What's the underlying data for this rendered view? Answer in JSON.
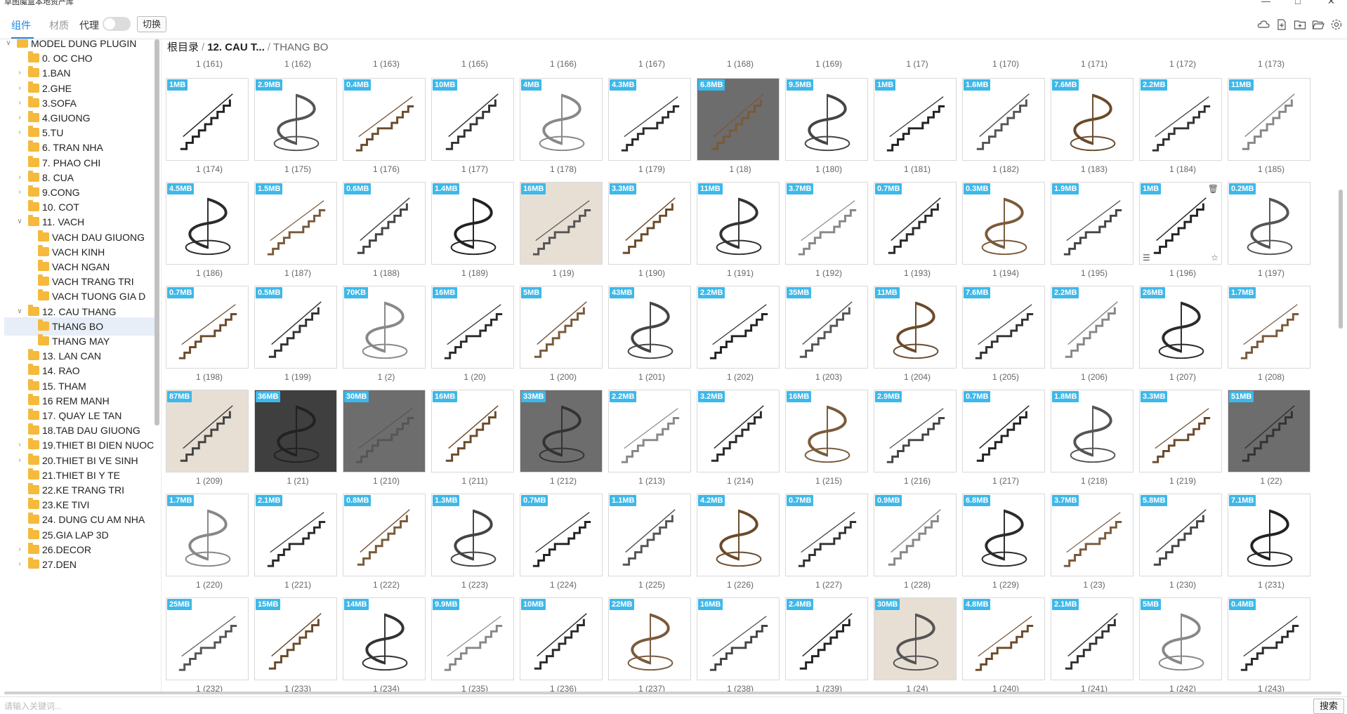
{
  "window": {
    "title": "草图魔盒本地资产库",
    "controls": [
      "minimize",
      "maximize",
      "close"
    ]
  },
  "toolbar": {
    "tabs": [
      {
        "label": "组件",
        "active": true
      },
      {
        "label": "材质",
        "active": false
      }
    ],
    "proxy_label": "代理",
    "proxy_enabled": false,
    "switch_label": "切换",
    "icons": [
      "cloud-icon",
      "add-file-icon",
      "new-folder-icon",
      "open-folder-icon",
      "settings-icon"
    ],
    "accent_color": "#1e88e5"
  },
  "sidebar": {
    "items": [
      {
        "label": "MODEL DUNG PLUGIN",
        "level": 0,
        "caret": "down"
      },
      {
        "label": "0. OC CHO",
        "level": 1,
        "caret": "none"
      },
      {
        "label": "1.BAN",
        "level": 1,
        "caret": "right"
      },
      {
        "label": "2.GHE",
        "level": 1,
        "caret": "right"
      },
      {
        "label": "3.SOFA",
        "level": 1,
        "caret": "right"
      },
      {
        "label": "4.GIUONG",
        "level": 1,
        "caret": "right"
      },
      {
        "label": "5.TU",
        "level": 1,
        "caret": "right"
      },
      {
        "label": "6. TRAN NHA",
        "level": 1,
        "caret": "none"
      },
      {
        "label": "7. PHAO CHI",
        "level": 1,
        "caret": "none"
      },
      {
        "label": "8. CUA",
        "level": 1,
        "caret": "right"
      },
      {
        "label": "9.CONG",
        "level": 1,
        "caret": "right"
      },
      {
        "label": "10. COT",
        "level": 1,
        "caret": "none"
      },
      {
        "label": "11. VACH",
        "level": 1,
        "caret": "down"
      },
      {
        "label": "VACH DAU GIUONG",
        "level": 2,
        "caret": "none"
      },
      {
        "label": "VACH KINH",
        "level": 2,
        "caret": "none"
      },
      {
        "label": "VACH NGAN",
        "level": 2,
        "caret": "none"
      },
      {
        "label": "VACH TRANG TRI",
        "level": 2,
        "caret": "none"
      },
      {
        "label": "VACH TUONG GIA D",
        "level": 2,
        "caret": "none"
      },
      {
        "label": "12. CAU THANG",
        "level": 1,
        "caret": "down"
      },
      {
        "label": "THANG BO",
        "level": 2,
        "caret": "none",
        "selected": true
      },
      {
        "label": "THANG MAY",
        "level": 2,
        "caret": "none"
      },
      {
        "label": "13. LAN CAN",
        "level": 1,
        "caret": "none"
      },
      {
        "label": "14. RAO",
        "level": 1,
        "caret": "none"
      },
      {
        "label": "15. THAM",
        "level": 1,
        "caret": "none"
      },
      {
        "label": "16 REM MANH",
        "level": 1,
        "caret": "none"
      },
      {
        "label": "17. QUAY LE TAN",
        "level": 1,
        "caret": "none"
      },
      {
        "label": "18.TAB DAU GIUONG",
        "level": 1,
        "caret": "none"
      },
      {
        "label": "19.THIET BI DIEN NUOC",
        "level": 1,
        "caret": "right"
      },
      {
        "label": "20.THIET BI VE SINH",
        "level": 1,
        "caret": "right"
      },
      {
        "label": "21.THIET BI Y TE",
        "level": 1,
        "caret": "none"
      },
      {
        "label": "22.KE TRANG TRI",
        "level": 1,
        "caret": "none"
      },
      {
        "label": "23.KE TIVI",
        "level": 1,
        "caret": "none"
      },
      {
        "label": "24. DUNG CU AM NHA",
        "level": 1,
        "caret": "none"
      },
      {
        "label": "25.GIA LAP 3D",
        "level": 1,
        "caret": "none"
      },
      {
        "label": "26.DECOR",
        "level": 1,
        "caret": "right"
      },
      {
        "label": "27.DEN",
        "level": 1,
        "caret": "right"
      }
    ]
  },
  "breadcrumb": {
    "root": "根目录",
    "middle": "12. CAU T...",
    "current": "THANG BO",
    "separator": "/"
  },
  "grid": {
    "top_labels": [
      "1 (161)",
      "1 (162)",
      "1 (163)",
      "1 (165)",
      "1 (166)",
      "1 (167)",
      "1 (168)",
      "1 (169)",
      "1 (17)",
      "1 (170)",
      "1 (171)",
      "1 (172)",
      "1 (173)"
    ],
    "rows": [
      {
        "sizes": [
          "1MB",
          "2.9MB",
          "0.4MB",
          "10MB",
          "4MB",
          "4.3MB",
          "6.8MB",
          "9.5MB",
          "1MB",
          "1.6MB",
          "7.6MB",
          "2.2MB",
          "11MB"
        ],
        "labels": [
          "1 (174)",
          "1 (175)",
          "1 (176)",
          "1 (177)",
          "1 (178)",
          "1 (179)",
          "1 (18)",
          "1 (180)",
          "1 (181)",
          "1 (182)",
          "1 (183)",
          "1 (184)",
          "1 (185)"
        ]
      },
      {
        "sizes": [
          "4.5MB",
          "1.5MB",
          "0.6MB",
          "1.4MB",
          "16MB",
          "3.3MB",
          "11MB",
          "3.7MB",
          "0.7MB",
          "0.3MB",
          "1.9MB",
          "1MB",
          "0.2MB"
        ],
        "labels": [
          "1 (186)",
          "1 (187)",
          "1 (188)",
          "1 (189)",
          "1 (19)",
          "1 (190)",
          "1 (191)",
          "1 (192)",
          "1 (193)",
          "1 (194)",
          "1 (195)",
          "1 (196)",
          "1 (197)"
        ]
      },
      {
        "sizes": [
          "0.7MB",
          "0.5MB",
          "70KB",
          "16MB",
          "5MB",
          "43MB",
          "2.2MB",
          "35MB",
          "11MB",
          "7.6MB",
          "2.2MB",
          "26MB",
          "1.7MB"
        ],
        "labels": [
          "1 (198)",
          "1 (199)",
          "1 (2)",
          "1 (20)",
          "1 (200)",
          "1 (201)",
          "1 (202)",
          "1 (203)",
          "1 (204)",
          "1 (205)",
          "1 (206)",
          "1 (207)",
          "1 (208)"
        ]
      },
      {
        "sizes": [
          "87MB",
          "36MB",
          "30MB",
          "16MB",
          "33MB",
          "2.2MB",
          "3.2MB",
          "16MB",
          "2.9MB",
          "0.7MB",
          "1.8MB",
          "3.3MB",
          "51MB"
        ],
        "labels": [
          "1 (209)",
          "1 (21)",
          "1 (210)",
          "1 (211)",
          "1 (212)",
          "1 (213)",
          "1 (214)",
          "1 (215)",
          "1 (216)",
          "1 (217)",
          "1 (218)",
          "1 (219)",
          "1 (22)"
        ]
      },
      {
        "sizes": [
          "1.7MB",
          "2.1MB",
          "0.8MB",
          "1.3MB",
          "0.7MB",
          "1.1MB",
          "4.2MB",
          "0.7MB",
          "0.9MB",
          "6.8MB",
          "3.7MB",
          "5.8MB",
          "7.1MB"
        ],
        "labels": [
          "1 (220)",
          "1 (221)",
          "1 (222)",
          "1 (223)",
          "1 (224)",
          "1 (225)",
          "1 (226)",
          "1 (227)",
          "1 (228)",
          "1 (229)",
          "1 (23)",
          "1 (230)",
          "1 (231)"
        ]
      },
      {
        "sizes": [
          "25MB",
          "15MB",
          "14MB",
          "9.9MB",
          "10MB",
          "22MB",
          "16MB",
          "2.4MB",
          "30MB",
          "4.8MB",
          "2.1MB",
          "5MB",
          "0.4MB"
        ],
        "labels": [
          "1 (232)",
          "1 (233)",
          "1 (234)",
          "1 (235)",
          "1 (236)",
          "1 (237)",
          "1 (238)",
          "1 (239)",
          "1 (24)",
          "1 (240)",
          "1 (241)",
          "1 (242)",
          "1 (243)"
        ]
      }
    ],
    "badge_color": "#3db8ea"
  },
  "search": {
    "placeholder": "请输入关键词...",
    "value": "",
    "button_label": "搜索"
  }
}
